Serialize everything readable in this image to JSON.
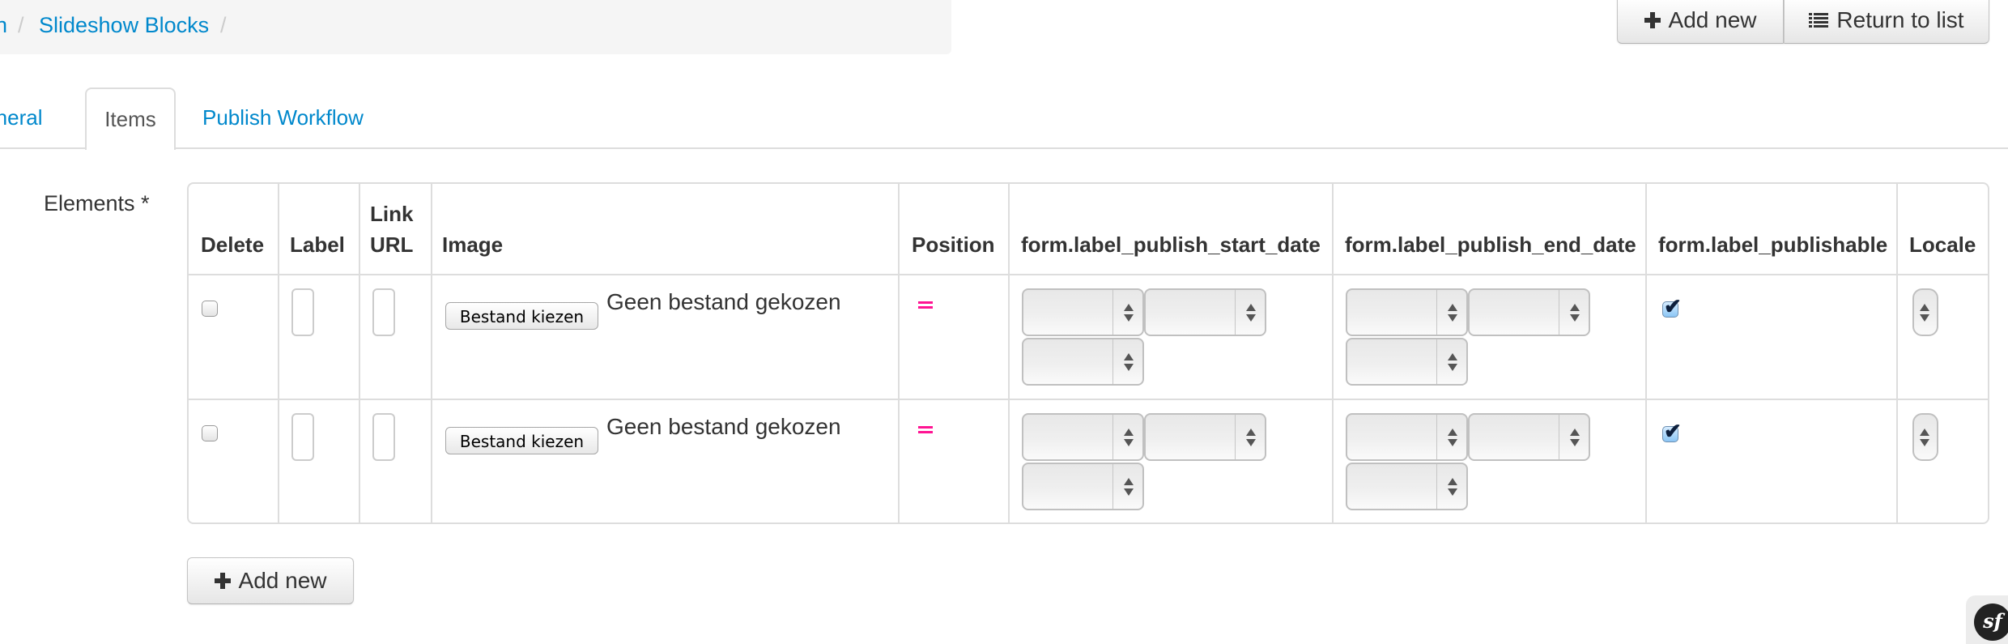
{
  "breadcrumb": {
    "items": [
      {
        "label": "n",
        "link": true
      },
      {
        "label": "Slideshow Blocks",
        "link": true
      }
    ],
    "separator": "/"
  },
  "actions": {
    "add_new_label": "Add new",
    "return_label": "Return to list"
  },
  "tabs": [
    {
      "label": "General",
      "active": false
    },
    {
      "label": "Items",
      "active": true
    },
    {
      "label": "Publish Workflow",
      "active": false
    }
  ],
  "form": {
    "elements_label": "Elements *",
    "columns": [
      {
        "key": "delete",
        "label_line1": "",
        "label_line2": "Delete"
      },
      {
        "key": "label",
        "label_line1": "",
        "label_line2": "Label"
      },
      {
        "key": "link_url",
        "label_line1": "Link",
        "label_line2": "URL"
      },
      {
        "key": "image",
        "label_line1": "",
        "label_line2": "Image"
      },
      {
        "key": "position",
        "label_line1": "",
        "label_line2": "Position"
      },
      {
        "key": "publish_start",
        "label_line1": "",
        "label_line2": "form.label_publish_start_date"
      },
      {
        "key": "publish_end",
        "label_line1": "",
        "label_line2": "form.label_publish_end_date"
      },
      {
        "key": "publishable",
        "label_line1": "",
        "label_line2": "form.label_publishable"
      },
      {
        "key": "locale",
        "label_line1": "",
        "label_line2": "Locale"
      }
    ],
    "rows": [
      {
        "delete": false,
        "label": "",
        "link_url": "",
        "file_button": "Bestand kiezen",
        "file_status": "Geen bestand gekozen",
        "position_icon": "drag-handle",
        "publish_start": [
          "",
          "",
          ""
        ],
        "publish_end": [
          "",
          "",
          ""
        ],
        "publishable": true,
        "locale": ""
      },
      {
        "delete": false,
        "label": "",
        "link_url": "",
        "file_button": "Bestand kiezen",
        "file_status": "Geen bestand gekozen",
        "position_icon": "drag-handle",
        "publish_start": [
          "",
          "",
          ""
        ],
        "publish_end": [
          "",
          "",
          ""
        ],
        "publishable": true,
        "locale": ""
      }
    ],
    "add_new_label": "Add new"
  },
  "colors": {
    "link": "#0088cc",
    "drag_handle": "#ff1493",
    "border": "#dddddd"
  },
  "debug_toolbar": {
    "icon": "symfony-icon",
    "glyph": "sf"
  }
}
